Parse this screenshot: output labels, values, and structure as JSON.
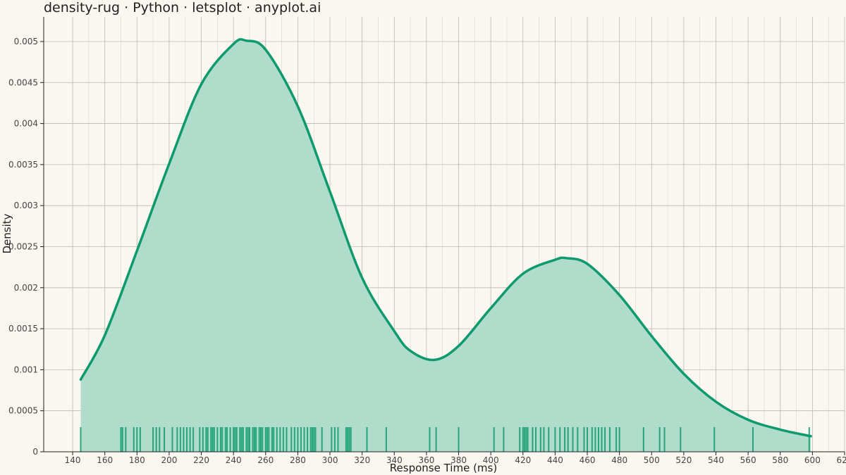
{
  "chart_data": {
    "type": "area",
    "title": "density-rug · Python · letsplot · anyplot.ai",
    "xlabel": "Response Time (ms)",
    "ylabel": "Density",
    "xlim": [
      122,
      620
    ],
    "ylim": [
      0,
      0.0053
    ],
    "x_ticks": [
      140,
      160,
      180,
      200,
      220,
      240,
      260,
      280,
      300,
      320,
      340,
      360,
      380,
      400,
      420,
      440,
      460,
      480,
      500,
      520,
      540,
      560,
      580,
      600,
      620
    ],
    "x_tick_labels": [
      "140",
      "160",
      "180",
      "200",
      "220",
      "240",
      "260",
      "280",
      "300",
      "320",
      "340",
      "360",
      "380",
      "400",
      "420",
      "440",
      "460",
      "480",
      "500",
      "520",
      "540",
      "560",
      "580",
      "600",
      "620"
    ],
    "y_ticks": [
      0,
      0.0005,
      0.001,
      0.0015,
      0.002,
      0.0025,
      0.003,
      0.0035,
      0.004,
      0.0045,
      0.005
    ],
    "y_tick_labels": [
      "0",
      "0.0005",
      "0.001",
      "0.0015",
      "0.002",
      "0.0025",
      "0.003",
      "0.0035",
      "0.004",
      "0.0045",
      "0.005"
    ],
    "grid": true,
    "colors": {
      "line": "#0E9A6E",
      "fill": "#B0DDCB",
      "rug": "#0E9A6E",
      "grid": "#BDB8AE",
      "axis": "#222222",
      "background": "#FAF7F1"
    },
    "density": {
      "x": [
        145,
        160,
        180,
        200,
        220,
        240,
        248,
        260,
        280,
        300,
        320,
        340,
        350,
        365,
        380,
        400,
        420,
        440,
        447,
        460,
        480,
        500,
        520,
        540,
        560,
        580,
        599
      ],
      "y": [
        0.00088,
        0.00142,
        0.00245,
        0.00351,
        0.00448,
        0.00497,
        0.00501,
        0.0049,
        0.00421,
        0.00317,
        0.00212,
        0.00147,
        0.00123,
        0.00112,
        0.00129,
        0.00175,
        0.00217,
        0.00234,
        0.00236,
        0.00229,
        0.00191,
        0.00141,
        0.00095,
        0.00061,
        0.00039,
        0.00027,
        0.00019
      ]
    },
    "rug": [
      145,
      170,
      171,
      173,
      178,
      180,
      182,
      190,
      192,
      194,
      197,
      202,
      205,
      207,
      209,
      211,
      213,
      215,
      219,
      221,
      223,
      224,
      226,
      227,
      228,
      230,
      232,
      233,
      235,
      236,
      238,
      240,
      241,
      242,
      244,
      245,
      246,
      248,
      249,
      250,
      252,
      253,
      254,
      256,
      257,
      258,
      260,
      261,
      262,
      264,
      265,
      267,
      269,
      271,
      273,
      276,
      278,
      280,
      282,
      284,
      286,
      288,
      289,
      290,
      291,
      295,
      301,
      303,
      305,
      310,
      311,
      312,
      313,
      323,
      335,
      362,
      366,
      380,
      402,
      408,
      418,
      420,
      421,
      422,
      423,
      426,
      428,
      431,
      433,
      436,
      440,
      443,
      446,
      448,
      451,
      454,
      458,
      460,
      463,
      465,
      467,
      469,
      471,
      474,
      478,
      480,
      495,
      505,
      508,
      518,
      539,
      563,
      598
    ]
  }
}
